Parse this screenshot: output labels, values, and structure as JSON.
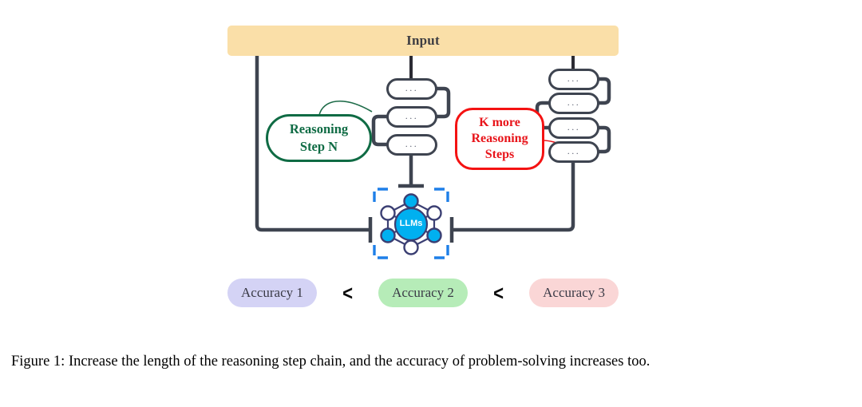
{
  "figure": {
    "input_block": {
      "label": "Input",
      "color": "#fadfa8"
    },
    "middle_chain": {
      "pill_text": "...",
      "pill_count": 3,
      "pills": [
        {
          "text": "..."
        },
        {
          "text": "..."
        },
        {
          "text": "..."
        }
      ]
    },
    "right_chain": {
      "pill_text": "...",
      "pill_count": 4,
      "pills": [
        {
          "text": "..."
        },
        {
          "text": "..."
        },
        {
          "text": "..."
        },
        {
          "text": "..."
        }
      ]
    },
    "callouts": {
      "green": {
        "line1": "Reasoning",
        "line2": "Step N",
        "color": "#0f6b44"
      },
      "red": {
        "line1": "K more",
        "line2": "Reasoning",
        "line3": "Steps",
        "color": "#e8141a"
      }
    },
    "llm_node": {
      "label": "LLMs",
      "accent_color": "#00b0f0",
      "frame_color": "#1e7fe8",
      "edge_color": "#3b3f73"
    },
    "accuracy": {
      "items": [
        {
          "label": "Accuracy 1",
          "color": "#d4d3f5"
        },
        {
          "label": "Accuracy 2",
          "color": "#b6ecb8"
        },
        {
          "label": "Accuracy 3",
          "color": "#fad6d6"
        }
      ],
      "operators": [
        "<",
        "<"
      ]
    }
  },
  "caption": {
    "text": "Figure 1: Increase the length of the reasoning step chain, and the accuracy of problem-solving increases too."
  }
}
